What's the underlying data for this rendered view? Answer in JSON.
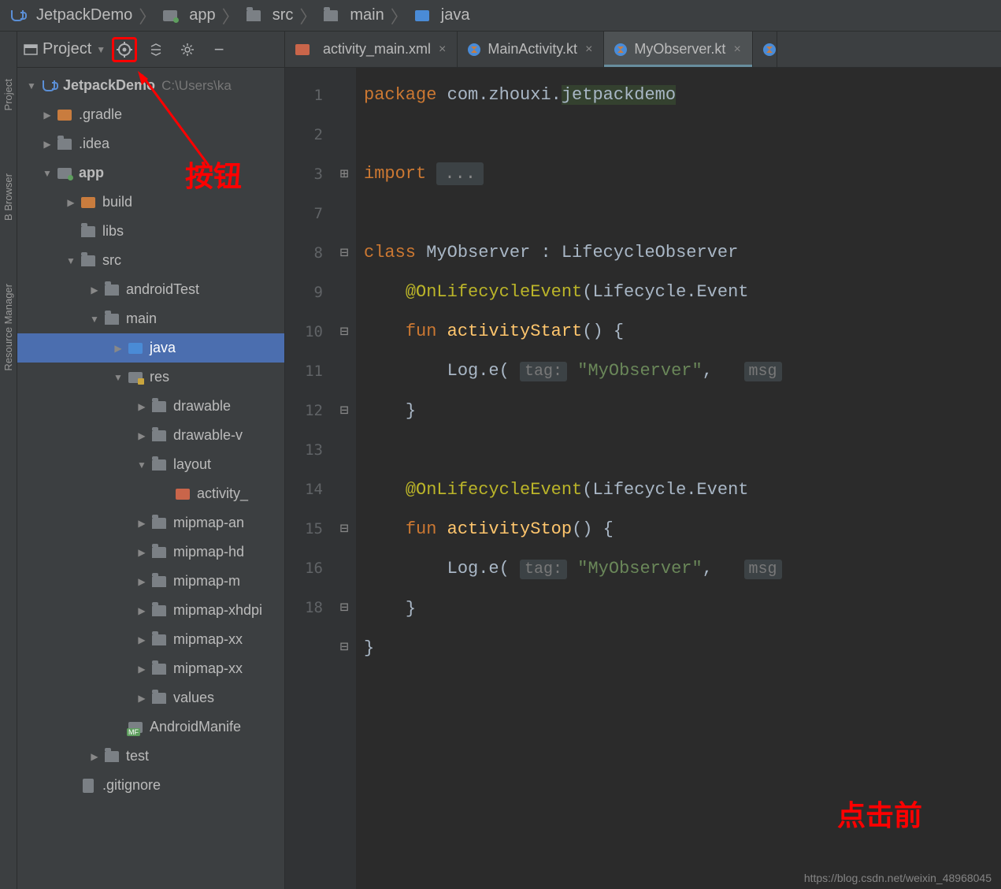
{
  "breadcrumb": [
    {
      "icon": "cup",
      "label": "JetpackDemo"
    },
    {
      "icon": "folder-module",
      "label": "app"
    },
    {
      "icon": "folder",
      "label": "src"
    },
    {
      "icon": "folder",
      "label": "main"
    },
    {
      "icon": "folder-blue",
      "label": "java"
    }
  ],
  "panel": {
    "title": "Project",
    "collapse_icon": "−"
  },
  "rail": {
    "project": "Project",
    "browser": "B Browser",
    "resource": "Resource Manager"
  },
  "tree": {
    "root": {
      "label": "JetpackDemo",
      "path": "C:\\Users\\ka"
    },
    "items": {
      "gradle": ".gradle",
      "idea": ".idea",
      "app": "app",
      "build": "build",
      "libs": "libs",
      "src": "src",
      "androidTest": "androidTest",
      "main": "main",
      "java": "java",
      "res": "res",
      "drawable": "drawable",
      "drawable_v": "drawable-v",
      "layout": "layout",
      "activity_xml": "activity_",
      "mipmap_an": "mipmap-an",
      "mipmap_hd": "mipmap-hd",
      "mipmap_md": "mipmap-m",
      "mipmap_xhdpi": "mipmap-xhdpi",
      "mipmap_xx": "mipmap-xx",
      "mipmap_xx2": "mipmap-xx",
      "values": "values",
      "manifest": "AndroidManife",
      "test": "test",
      "gitignore": ".gitignore"
    }
  },
  "tabs": [
    {
      "icon": "xml",
      "label": "activity_main.xml",
      "active": false
    },
    {
      "icon": "kt",
      "label": "MainActivity.kt",
      "active": false
    },
    {
      "icon": "kt",
      "label": "MyObserver.kt",
      "active": true
    },
    {
      "icon": "kt",
      "label": "",
      "active": false,
      "partial": true
    }
  ],
  "editor": {
    "line_numbers": [
      "1",
      "2",
      "3",
      "7",
      "8",
      "9",
      "10",
      "11",
      "12",
      "13",
      "14",
      "15",
      "16",
      "",
      "18"
    ],
    "code": {
      "l1_kw": "package",
      "l1_pkg_a": "com.zhouxi.",
      "l1_pkg_b": "jetpackdemo",
      "l3_kw": "import",
      "l3_dots": "...",
      "l8_kw": "class",
      "l8_cls": "MyObserver",
      "l8_sep": " : ",
      "l8_iface": "LifecycleObserver",
      "l9_anno": "@OnLifecycleEvent",
      "l9_open": "(",
      "l9_arg": "Lifecycle.Event",
      "l10_kw": "fun",
      "l10_fn": "activityStart",
      "l10_args": "()",
      "l10_brace": " {",
      "l11_log": "Log.e(",
      "l11_hint": "tag:",
      "l11_str": "\"MyObserver\"",
      "l11_comma": ",",
      "l11_hint2": "msg",
      "l12_brace": "}",
      "l14_anno": "@OnLifecycleEvent",
      "l14_open": "(",
      "l14_arg": "Lifecycle.Event",
      "l15_kw": "fun",
      "l15_fn": "activityStop",
      "l15_args": "()",
      "l15_brace": " {",
      "l16_log": "Log.e(",
      "l16_hint": "tag:",
      "l16_str": "\"MyObserver\"",
      "l16_comma": ",",
      "l16_hint2": "msg",
      "l17_brace": "}",
      "l18_brace": "}"
    }
  },
  "annotations": {
    "button_label": "按钮",
    "footer_label": "点击前"
  },
  "watermark": "https://blog.csdn.net/weixin_48968045"
}
